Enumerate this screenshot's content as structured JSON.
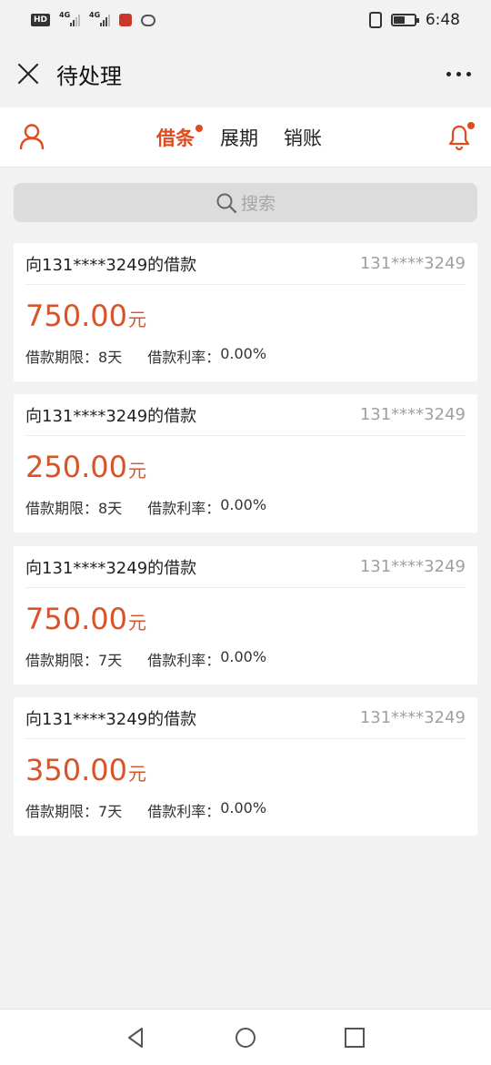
{
  "status_bar": {
    "hd": "HD",
    "net1": "4G",
    "net2": "4G",
    "time": "6:48"
  },
  "header": {
    "title": "待处理"
  },
  "tabs": [
    {
      "label": "借条",
      "active": true,
      "badge": true
    },
    {
      "label": "展期",
      "active": false
    },
    {
      "label": "销账",
      "active": false
    }
  ],
  "search": {
    "placeholder": "搜索"
  },
  "loans": [
    {
      "title": "向131****3249的借款",
      "phone": "131****3249",
      "amount": "750.00",
      "unit": "元",
      "term_label": "借款期限：",
      "term_value": "8天",
      "rate_label": "借款利率：",
      "rate_value": "0.00%"
    },
    {
      "title": "向131****3249的借款",
      "phone": "131****3249",
      "amount": "250.00",
      "unit": "元",
      "term_label": "借款期限：",
      "term_value": "8天",
      "rate_label": "借款利率：",
      "rate_value": "0.00%"
    },
    {
      "title": "向131****3249的借款",
      "phone": "131****3249",
      "amount": "750.00",
      "unit": "元",
      "term_label": "借款期限：",
      "term_value": "7天",
      "rate_label": "借款利率：",
      "rate_value": "0.00%"
    },
    {
      "title": "向131****3249的借款",
      "phone": "131****3249",
      "amount": "350.00",
      "unit": "元",
      "term_label": "借款期限：",
      "term_value": "7天",
      "rate_label": "借款利率：",
      "rate_value": "0.00%"
    }
  ],
  "colors": {
    "accent": "#e04a1f",
    "amount": "#d9532a",
    "background": "#f2f2f2"
  },
  "icons": {
    "close": "close-icon",
    "more": "more-icon",
    "user": "user-icon",
    "bell": "bell-icon",
    "search": "search-icon",
    "back": "back-icon",
    "home": "home-icon",
    "recents": "recents-icon"
  }
}
